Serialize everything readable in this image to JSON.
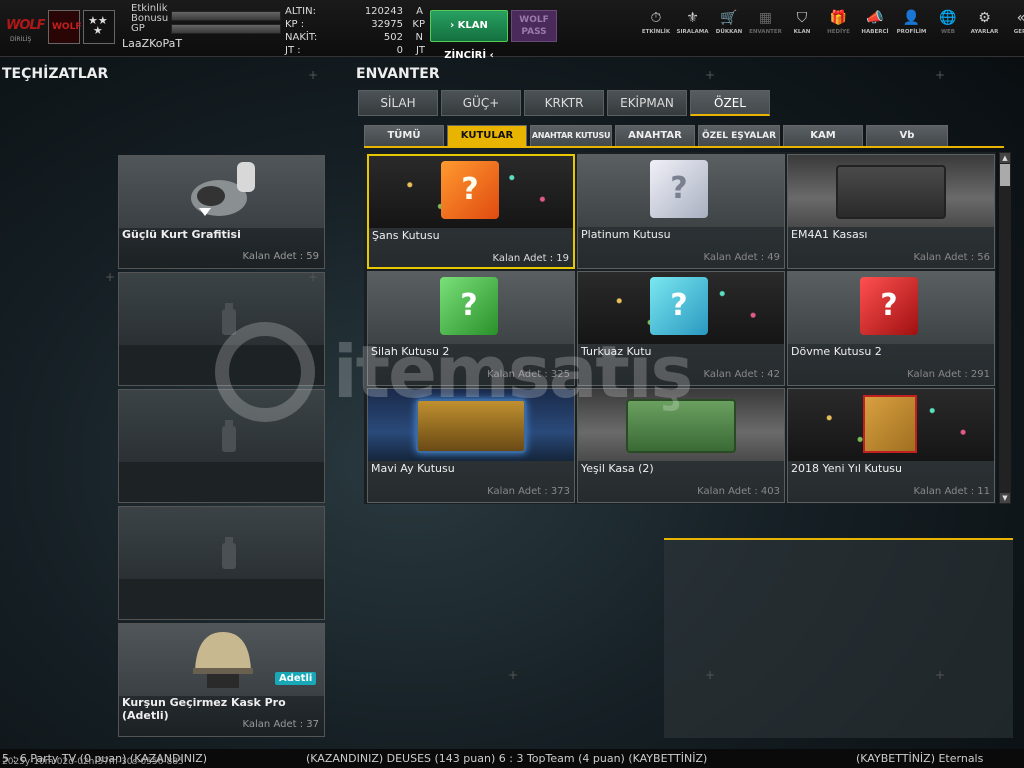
{
  "topbar": {
    "logos": {
      "game": "WOLF",
      "game_sub": "DİRİLİŞ",
      "clan": "WOLF",
      "rank": "★★\n★"
    },
    "stats": {
      "event_bonus_label": "Etkinlik Bonusu",
      "gp_label": "GP"
    },
    "username": "LaaZKoPaT",
    "currency": [
      {
        "label": "ALTIN:",
        "value": "120243",
        "unit": "A"
      },
      {
        "label": "KP   :",
        "value": "32975",
        "unit": "KP"
      },
      {
        "label": "NAKİT:",
        "value": "502",
        "unit": "N"
      },
      {
        "label": "JT   :",
        "value": "0",
        "unit": "JT"
      }
    ],
    "klan_button": "› KLAN ZİNCİRİ ‹",
    "wolf_pass": "WOLF PASS",
    "nav": [
      {
        "label": "ETKİNLİK",
        "icon": "stopwatch-icon",
        "glyph": "⏱"
      },
      {
        "label": "SIRALAMA",
        "icon": "medal-icon",
        "glyph": "⚜"
      },
      {
        "label": "DÜKKAN",
        "icon": "cart-icon",
        "glyph": "🛒"
      },
      {
        "label": "ENVANTER",
        "icon": "inventory-icon",
        "glyph": "▦"
      },
      {
        "label": "KLAN",
        "icon": "shield-icon",
        "glyph": "⛉"
      },
      {
        "label": "HEDİYE",
        "icon": "gift-icon",
        "glyph": "🎁"
      },
      {
        "label": "HABERCİ",
        "icon": "megaphone-icon",
        "glyph": "📣"
      },
      {
        "label": "PROFİLİM",
        "icon": "profile-icon",
        "glyph": "👤"
      },
      {
        "label": "WEB",
        "icon": "globe-icon",
        "glyph": "🌐"
      },
      {
        "label": "AYARLAR",
        "icon": "gear-icon",
        "glyph": "⚙"
      },
      {
        "label": "GERİ",
        "icon": "back-icon",
        "glyph": "«"
      }
    ]
  },
  "equipment": {
    "title": "TEÇHİZATLAR",
    "slots": [
      {
        "name": "Güçlü Kurt Grafitisi",
        "count": "Kalan Adet : 59"
      },
      {
        "name": "",
        "count": ""
      },
      {
        "name": "",
        "count": ""
      },
      {
        "name": "",
        "count": ""
      },
      {
        "name": "Kurşun Geçirmez Kask Pro (Adetli)",
        "count": "Kalan Adet : 37",
        "badge": "Adetli"
      }
    ]
  },
  "inventory": {
    "title": "ENVANTER",
    "tabs": [
      "SİLAH",
      "GÜÇ+",
      "KRKTR",
      "EKİPMAN",
      "ÖZEL"
    ],
    "active_tab": "ÖZEL",
    "subtabs": [
      "TÜMÜ",
      "KUTULAR",
      "ANAHTAR KUTUSU",
      "ANAHTAR",
      "ÖZEL EŞYALAR",
      "KAM",
      "Vb"
    ],
    "active_subtab": "KUTULAR",
    "items": [
      {
        "name": "Şans Kutusu",
        "count": "Kalan Adet : 19"
      },
      {
        "name": "Platinum Kutusu",
        "count": "Kalan Adet : 49"
      },
      {
        "name": "EM4A1 Kasası",
        "count": "Kalan Adet : 56"
      },
      {
        "name": "Silah Kutusu 2",
        "count": "Kalan Adet : 325"
      },
      {
        "name": "Turkuaz Kutu",
        "count": "Kalan Adet : 42"
      },
      {
        "name": "Dövme Kutusu 2",
        "count": "Kalan Adet : 291"
      },
      {
        "name": "Mavi Ay Kutusu",
        "count": "Kalan Adet : 373"
      },
      {
        "name": "Yeşil Kasa (2)",
        "count": "Kalan Adet : 403"
      },
      {
        "name": "2018 Yeni Yıl Kutusu",
        "count": "Kalan Adet : 11"
      }
    ],
    "box_glyph": "?"
  },
  "ticker": {
    "a": "5 : 6 Party TV (0 puan) (KAZANDINIZ)",
    "b": "(KAZANDINIZ) DEUSES (143 puan) 6 : 3 TopTeam (4 puan) (KAYBETTİNİZ)",
    "c": "(KAYBETTİNİZ) Eternals"
  },
  "timestamp": "2025y-10m-02d-02h-57m-30s-0556-885",
  "watermark": "itemsatış"
}
